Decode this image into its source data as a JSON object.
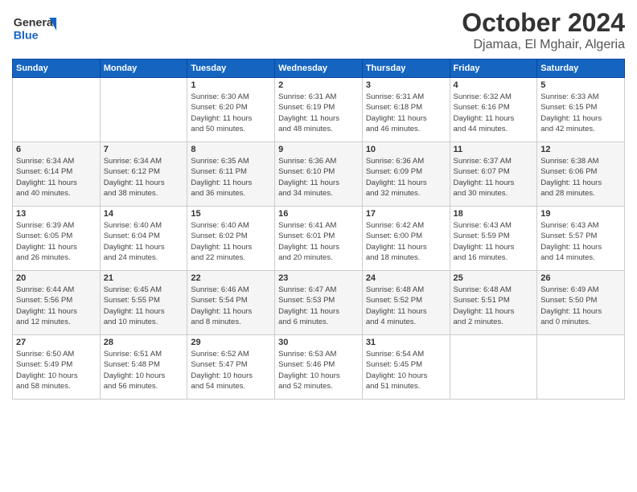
{
  "header": {
    "logo_line1": "General",
    "logo_line2": "Blue",
    "title": "October 2024",
    "subtitle": "Djamaa, El Mghair, Algeria"
  },
  "calendar": {
    "days_of_week": [
      "Sunday",
      "Monday",
      "Tuesday",
      "Wednesday",
      "Thursday",
      "Friday",
      "Saturday"
    ],
    "weeks": [
      [
        {
          "day": "",
          "info": ""
        },
        {
          "day": "",
          "info": ""
        },
        {
          "day": "1",
          "info": "Sunrise: 6:30 AM\nSunset: 6:20 PM\nDaylight: 11 hours\nand 50 minutes."
        },
        {
          "day": "2",
          "info": "Sunrise: 6:31 AM\nSunset: 6:19 PM\nDaylight: 11 hours\nand 48 minutes."
        },
        {
          "day": "3",
          "info": "Sunrise: 6:31 AM\nSunset: 6:18 PM\nDaylight: 11 hours\nand 46 minutes."
        },
        {
          "day": "4",
          "info": "Sunrise: 6:32 AM\nSunset: 6:16 PM\nDaylight: 11 hours\nand 44 minutes."
        },
        {
          "day": "5",
          "info": "Sunrise: 6:33 AM\nSunset: 6:15 PM\nDaylight: 11 hours\nand 42 minutes."
        }
      ],
      [
        {
          "day": "6",
          "info": "Sunrise: 6:34 AM\nSunset: 6:14 PM\nDaylight: 11 hours\nand 40 minutes."
        },
        {
          "day": "7",
          "info": "Sunrise: 6:34 AM\nSunset: 6:12 PM\nDaylight: 11 hours\nand 38 minutes."
        },
        {
          "day": "8",
          "info": "Sunrise: 6:35 AM\nSunset: 6:11 PM\nDaylight: 11 hours\nand 36 minutes."
        },
        {
          "day": "9",
          "info": "Sunrise: 6:36 AM\nSunset: 6:10 PM\nDaylight: 11 hours\nand 34 minutes."
        },
        {
          "day": "10",
          "info": "Sunrise: 6:36 AM\nSunset: 6:09 PM\nDaylight: 11 hours\nand 32 minutes."
        },
        {
          "day": "11",
          "info": "Sunrise: 6:37 AM\nSunset: 6:07 PM\nDaylight: 11 hours\nand 30 minutes."
        },
        {
          "day": "12",
          "info": "Sunrise: 6:38 AM\nSunset: 6:06 PM\nDaylight: 11 hours\nand 28 minutes."
        }
      ],
      [
        {
          "day": "13",
          "info": "Sunrise: 6:39 AM\nSunset: 6:05 PM\nDaylight: 11 hours\nand 26 minutes."
        },
        {
          "day": "14",
          "info": "Sunrise: 6:40 AM\nSunset: 6:04 PM\nDaylight: 11 hours\nand 24 minutes."
        },
        {
          "day": "15",
          "info": "Sunrise: 6:40 AM\nSunset: 6:02 PM\nDaylight: 11 hours\nand 22 minutes."
        },
        {
          "day": "16",
          "info": "Sunrise: 6:41 AM\nSunset: 6:01 PM\nDaylight: 11 hours\nand 20 minutes."
        },
        {
          "day": "17",
          "info": "Sunrise: 6:42 AM\nSunset: 6:00 PM\nDaylight: 11 hours\nand 18 minutes."
        },
        {
          "day": "18",
          "info": "Sunrise: 6:43 AM\nSunset: 5:59 PM\nDaylight: 11 hours\nand 16 minutes."
        },
        {
          "day": "19",
          "info": "Sunrise: 6:43 AM\nSunset: 5:57 PM\nDaylight: 11 hours\nand 14 minutes."
        }
      ],
      [
        {
          "day": "20",
          "info": "Sunrise: 6:44 AM\nSunset: 5:56 PM\nDaylight: 11 hours\nand 12 minutes."
        },
        {
          "day": "21",
          "info": "Sunrise: 6:45 AM\nSunset: 5:55 PM\nDaylight: 11 hours\nand 10 minutes."
        },
        {
          "day": "22",
          "info": "Sunrise: 6:46 AM\nSunset: 5:54 PM\nDaylight: 11 hours\nand 8 minutes."
        },
        {
          "day": "23",
          "info": "Sunrise: 6:47 AM\nSunset: 5:53 PM\nDaylight: 11 hours\nand 6 minutes."
        },
        {
          "day": "24",
          "info": "Sunrise: 6:48 AM\nSunset: 5:52 PM\nDaylight: 11 hours\nand 4 minutes."
        },
        {
          "day": "25",
          "info": "Sunrise: 6:48 AM\nSunset: 5:51 PM\nDaylight: 11 hours\nand 2 minutes."
        },
        {
          "day": "26",
          "info": "Sunrise: 6:49 AM\nSunset: 5:50 PM\nDaylight: 11 hours\nand 0 minutes."
        }
      ],
      [
        {
          "day": "27",
          "info": "Sunrise: 6:50 AM\nSunset: 5:49 PM\nDaylight: 10 hours\nand 58 minutes."
        },
        {
          "day": "28",
          "info": "Sunrise: 6:51 AM\nSunset: 5:48 PM\nDaylight: 10 hours\nand 56 minutes."
        },
        {
          "day": "29",
          "info": "Sunrise: 6:52 AM\nSunset: 5:47 PM\nDaylight: 10 hours\nand 54 minutes."
        },
        {
          "day": "30",
          "info": "Sunrise: 6:53 AM\nSunset: 5:46 PM\nDaylight: 10 hours\nand 52 minutes."
        },
        {
          "day": "31",
          "info": "Sunrise: 6:54 AM\nSunset: 5:45 PM\nDaylight: 10 hours\nand 51 minutes."
        },
        {
          "day": "",
          "info": ""
        },
        {
          "day": "",
          "info": ""
        }
      ]
    ]
  }
}
